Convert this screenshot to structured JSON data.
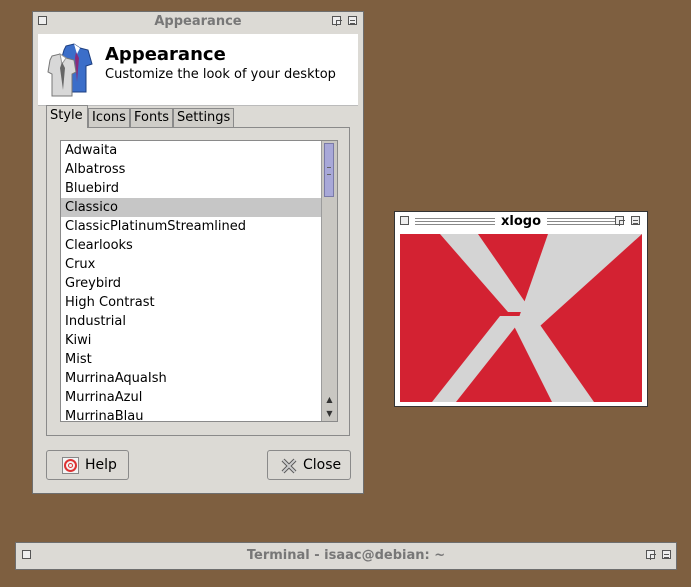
{
  "appearance_window": {
    "title": "Appearance",
    "header_title": "Appearance",
    "header_subtitle": "Customize the look of your desktop",
    "tabs": [
      {
        "label": "Style"
      },
      {
        "label": "Icons"
      },
      {
        "label": "Fonts"
      },
      {
        "label": "Settings"
      }
    ],
    "themes": [
      "Adwaita",
      "Albatross",
      "Bluebird",
      "Classico",
      "ClassicPlatinumStreamlined",
      "Clearlooks",
      "Crux",
      "Greybird",
      "High Contrast",
      "Industrial",
      "Kiwi",
      "Mist",
      "MurrinaAquaIsh",
      "MurrinaAzul",
      "MurrinaBlau"
    ],
    "selected_theme": "Classico",
    "help_label": "Help",
    "close_label": "Close"
  },
  "xlogo_window": {
    "title": "xlogo"
  },
  "terminal_window": {
    "title": "Terminal - isaac@debian: ~"
  },
  "colors": {
    "desktop": "#7e5f40",
    "xlogo_red": "#d32232",
    "xlogo_gray": "#d4d4d4",
    "selection": "#c6c6c6"
  }
}
